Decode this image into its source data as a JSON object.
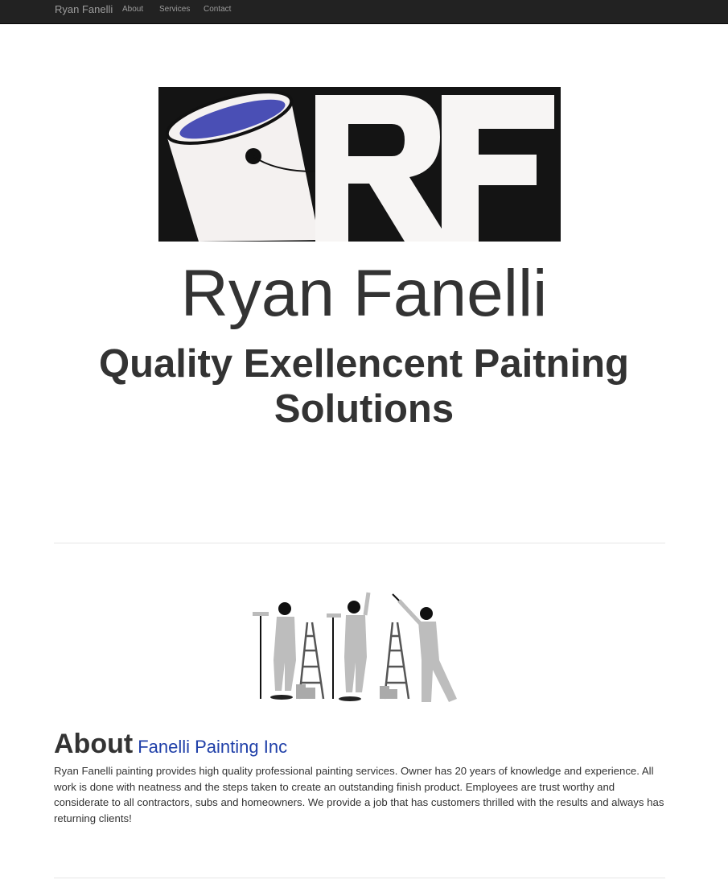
{
  "nav": {
    "brand": "Ryan Fanelli",
    "links": [
      "About",
      "Services",
      "Contact"
    ]
  },
  "logo": {
    "letters": "RF",
    "paint_color": "#4a4fb5"
  },
  "hero": {
    "title": "Ryan Fanelli",
    "subtitle": "Quality Exellencent Paitning Solutions"
  },
  "about": {
    "heading": "About",
    "subheading": "Fanelli Painting Inc",
    "text": "Ryan Fanelli painting provides high quality professional painting services. Owner has 20 years of knowledge and experience. All work is done with neatness and the steps taken to create an outstanding finish product. Employees are trust worthy and considerate to all contractors, subs and homeowners. We provide a job that has customers thrilled with the results and always has returning clients!"
  },
  "colors": {
    "navbar": "#222222",
    "nav_text": "#9d9d9d",
    "accent": "#1f3fa8"
  }
}
